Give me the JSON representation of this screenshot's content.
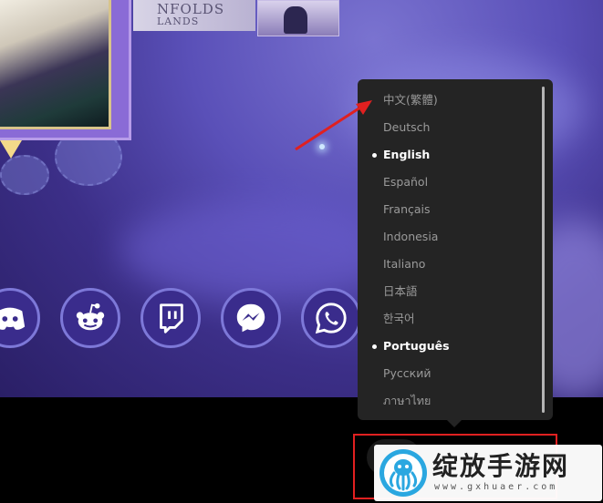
{
  "background_art": {
    "banner_line1": "NFOLDS",
    "banner_line2": "LANDS"
  },
  "social_icons": [
    {
      "name": "discord-icon"
    },
    {
      "name": "reddit-icon"
    },
    {
      "name": "twitch-icon"
    },
    {
      "name": "messenger-icon"
    },
    {
      "name": "whatsapp-icon"
    }
  ],
  "language_menu": {
    "items": [
      {
        "label": "中文(繁體)",
        "selected": false
      },
      {
        "label": "Deutsch",
        "selected": false
      },
      {
        "label": "English",
        "selected": true
      },
      {
        "label": "Español",
        "selected": false
      },
      {
        "label": "Français",
        "selected": false
      },
      {
        "label": "Indonesia",
        "selected": false
      },
      {
        "label": "Italiano",
        "selected": false
      },
      {
        "label": "日本語",
        "selected": false
      },
      {
        "label": "한국어",
        "selected": false
      },
      {
        "label": "Português",
        "selected": true
      },
      {
        "label": "Русский",
        "selected": false
      },
      {
        "label": "ภาษาไทย",
        "selected": false
      }
    ]
  },
  "watermark": {
    "title": "绽放手游网",
    "url": "www.gxhuaer.com"
  },
  "colors": {
    "menu_bg": "#242424",
    "menu_text": "#9a9a9a",
    "menu_selected": "#ffffff",
    "annotation_red": "#e02020",
    "icon_circle": "#3a2c8c"
  }
}
